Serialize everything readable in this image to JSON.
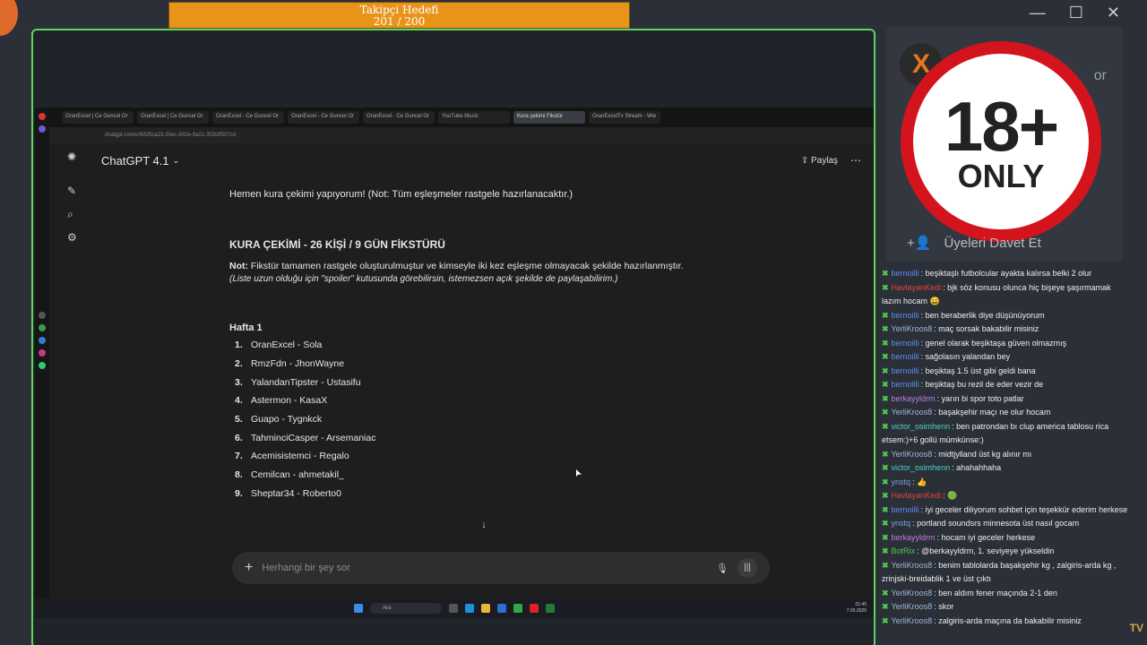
{
  "goal": {
    "title": "Takipçi Hedefi",
    "progress": "201 / 200",
    "fraction": 1.0
  },
  "browser": {
    "tabs": [
      "OranExcel | Ce Guncel Or",
      "OranExcel | Ce Guncel Or",
      "OranExcel - Ce Guncel Or",
      "OranExcel - Ce Guncel Or",
      "OranExcel - Ce Guncel Or",
      "YouTube Music",
      "Kura çekimi Fikstür",
      "OranExcelTv Stream - Ww"
    ],
    "url": "chatgpt.com/c/6820ca23-30ec-802e-9a21-3f2b3f507cd"
  },
  "chatgpt": {
    "title": "ChatGPT 4.1",
    "share_label": "Paylaş",
    "intro": "Hemen kura çekimi yapıyorum! (Not: Tüm eşleşmeler rastgele hazırlanacaktır.)",
    "heading": "KURA ÇEKİMİ - 26 KİŞİ / 9 GÜN FİKSTÜRÜ",
    "note_label": "Not:",
    "note": "Fikstür tamamen rastgele oluşturulmuştur ve kimseyle iki kez eşleşme olmayacak şekilde hazırlanmıştır.",
    "italic_note": "(Liste uzun olduğu için \"spoiler\" kutusunda görebilirsin, istemezsen açık şekilde de paylaşabilirim.)",
    "week": "Hafta 1",
    "fixtures": [
      {
        "n": "1.",
        "text": "OranExcel - Sola"
      },
      {
        "n": "2.",
        "text": "RmzFdn - JhonWayne"
      },
      {
        "n": "3.",
        "text": "YalandanTipster - Ustasifu"
      },
      {
        "n": "4.",
        "text": "Astermon - KasaX"
      },
      {
        "n": "5.",
        "text": "Guapo - Tygnkck"
      },
      {
        "n": "6.",
        "text": "TahminciCasper - Arsemaniac"
      },
      {
        "n": "7.",
        "text": "Acemisistemci - Regalo"
      },
      {
        "n": "8.",
        "text": "Cemilcan - ahmetakil_"
      },
      {
        "n": "9.",
        "text": "Sheptar34 - Roberto0"
      }
    ],
    "placeholder": "Herhangi bir şey sor"
  },
  "taskbar": {
    "search": "Ara",
    "time": "01:45",
    "date": "7.05.2025"
  },
  "discord": {
    "invite_label": "Üyeleri Davet Et",
    "partial_text": "or"
  },
  "badge": {
    "big": "18+",
    "small": "ONLY"
  },
  "chat": [
    {
      "user": "bernoilli",
      "color": "#5b8def",
      "text": ": beşiktaşlı futbolcular ayakta kalırsa belki 2 olur"
    },
    {
      "user": "HavlayanKedi",
      "color": "#e0443e",
      "text": ": bjk söz konusu olunca hiç bişeye şaşırmamak lazım hocam 😄"
    },
    {
      "user": "bernoilli",
      "color": "#5b8def",
      "text": ": ben beraberlik diye düşünüyorum"
    },
    {
      "user": "YerliKroos8",
      "color": "#9fb8d8",
      "text": ": maç sorsak bakabilir misiniz"
    },
    {
      "user": "bernoilli",
      "color": "#5b8def",
      "text": ": genel olarak beşiktaşa güven olmazmış"
    },
    {
      "user": "bernoilli",
      "color": "#5b8def",
      "text": ": sağolasın yalandan bey"
    },
    {
      "user": "bernoilli",
      "color": "#5b8def",
      "text": ": beşiktaş 1.5 üst gibi geldi bana"
    },
    {
      "user": "bernoilli",
      "color": "#5b8def",
      "text": ": beşiktaş bu rezil de eder vezir de"
    },
    {
      "user": "berkayyldrm",
      "color": "#c47ae0",
      "text": ": yarın bi spor toto patlar"
    },
    {
      "user": "YerliKroos8",
      "color": "#9fb8d8",
      "text": ": başakşehir maçı ne olur hocam"
    },
    {
      "user": "victor_osimhenn",
      "color": "#4fd0c8",
      "text": ": ben patrondan bı clup america tablosu rica etsem:)+6 gollü mümkünse:)"
    },
    {
      "user": "YerliKroos8",
      "color": "#9fb8d8",
      "text": ": midtjylland üst kg alınır mı"
    },
    {
      "user": "victor_osimhenn",
      "color": "#4fd0c8",
      "text": ": ahahahhaha"
    },
    {
      "user": "ynstq",
      "color": "#7da0e0",
      "text": ": 👍"
    },
    {
      "user": "HavlayanKedi",
      "color": "#e0443e",
      "text": ": 🟢"
    },
    {
      "user": "bernoilli",
      "color": "#5b8def",
      "text": ": iyi geceler diliyorum sohbet için teşekkür ederim herkese"
    },
    {
      "user": "ynstq",
      "color": "#7da0e0",
      "text": ": portland soundsrs minnesota üst nasıl gocam"
    },
    {
      "user": "berkayyldrm",
      "color": "#c47ae0",
      "text": ": hocam iyi geceler herkese"
    },
    {
      "user": "BotRix",
      "color": "#4fc94c",
      "text": ": @berkayyldrm, 1. seviyeye yükseldin"
    },
    {
      "user": "YerliKroos8",
      "color": "#9fb8d8",
      "text": ": benim tablolarda başakşehir kg , zalgiris-arda kg , zrinjski-breidablik 1 ve üst çıktı"
    },
    {
      "user": "YerliKroos8",
      "color": "#9fb8d8",
      "text": ": ben aldım fener maçında 2-1 den"
    },
    {
      "user": "YerliKroos8",
      "color": "#9fb8d8",
      "text": ": skor"
    },
    {
      "user": "YerliKroos8",
      "color": "#9fb8d8",
      "text": ": zalgiris-arda maçına da bakabilir misiniz"
    }
  ],
  "corner_logo": "TV",
  "colors": {
    "frame_border": "#5fd65a",
    "goal_bar": "#e8941b",
    "badge_ring": "#d4141d"
  }
}
